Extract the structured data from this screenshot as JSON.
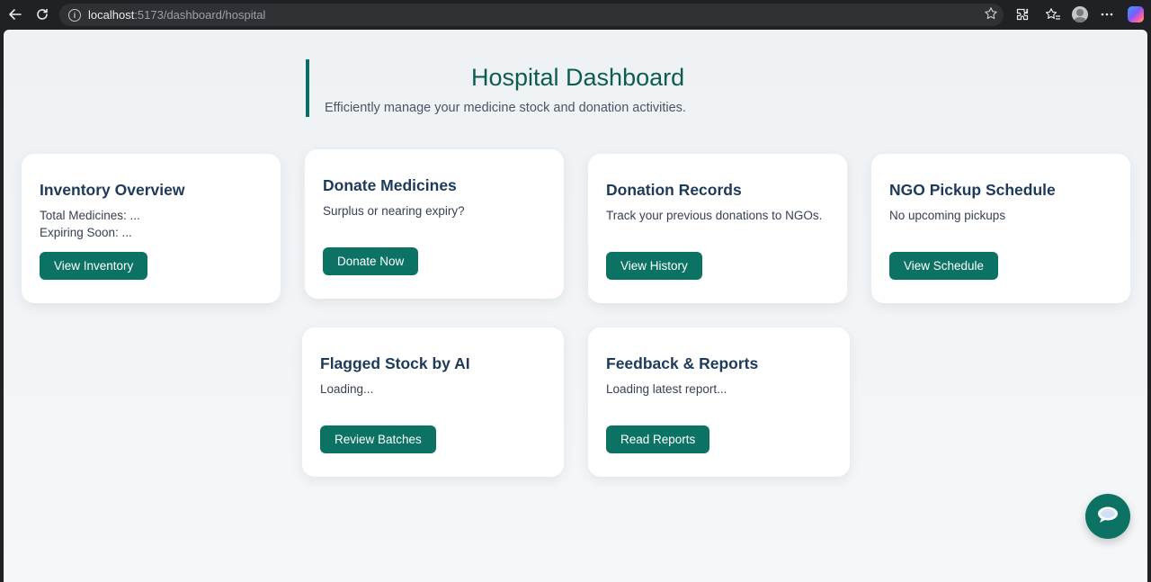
{
  "browser": {
    "url_host": "localhost",
    "url_rest": ":5173/dashboard/hospital",
    "icons": [
      "back-icon",
      "reload-icon",
      "info-icon",
      "star-icon",
      "extensions-icon",
      "favorites-icon",
      "profile-icon",
      "more-icon",
      "copilot-icon"
    ]
  },
  "header": {
    "title": "Hospital Dashboard",
    "subtitle": "Efficiently manage your medicine stock and donation activities."
  },
  "cards": {
    "inventory": {
      "title": "Inventory Overview",
      "line1": "Total Medicines: ...",
      "line2": "Expiring Soon: ...",
      "button": "View Inventory"
    },
    "donate": {
      "title": "Donate Medicines",
      "desc": "Surplus or nearing expiry?",
      "button": "Donate Now"
    },
    "records": {
      "title": "Donation Records",
      "desc": "Track your previous donations to NGOs.",
      "button": "View History"
    },
    "pickup": {
      "title": "NGO Pickup Schedule",
      "desc": "No upcoming pickups",
      "button": "View Schedule"
    },
    "flagged": {
      "title": "Flagged Stock by AI",
      "desc": "Loading...",
      "button": "Review Batches"
    },
    "feedback": {
      "title": "Feedback & Reports",
      "desc": "Loading latest report...",
      "button": "Read Reports"
    }
  },
  "colors": {
    "accent": "#0b7264",
    "title": "#0d5c52",
    "card_heading": "#1e3a5a"
  }
}
